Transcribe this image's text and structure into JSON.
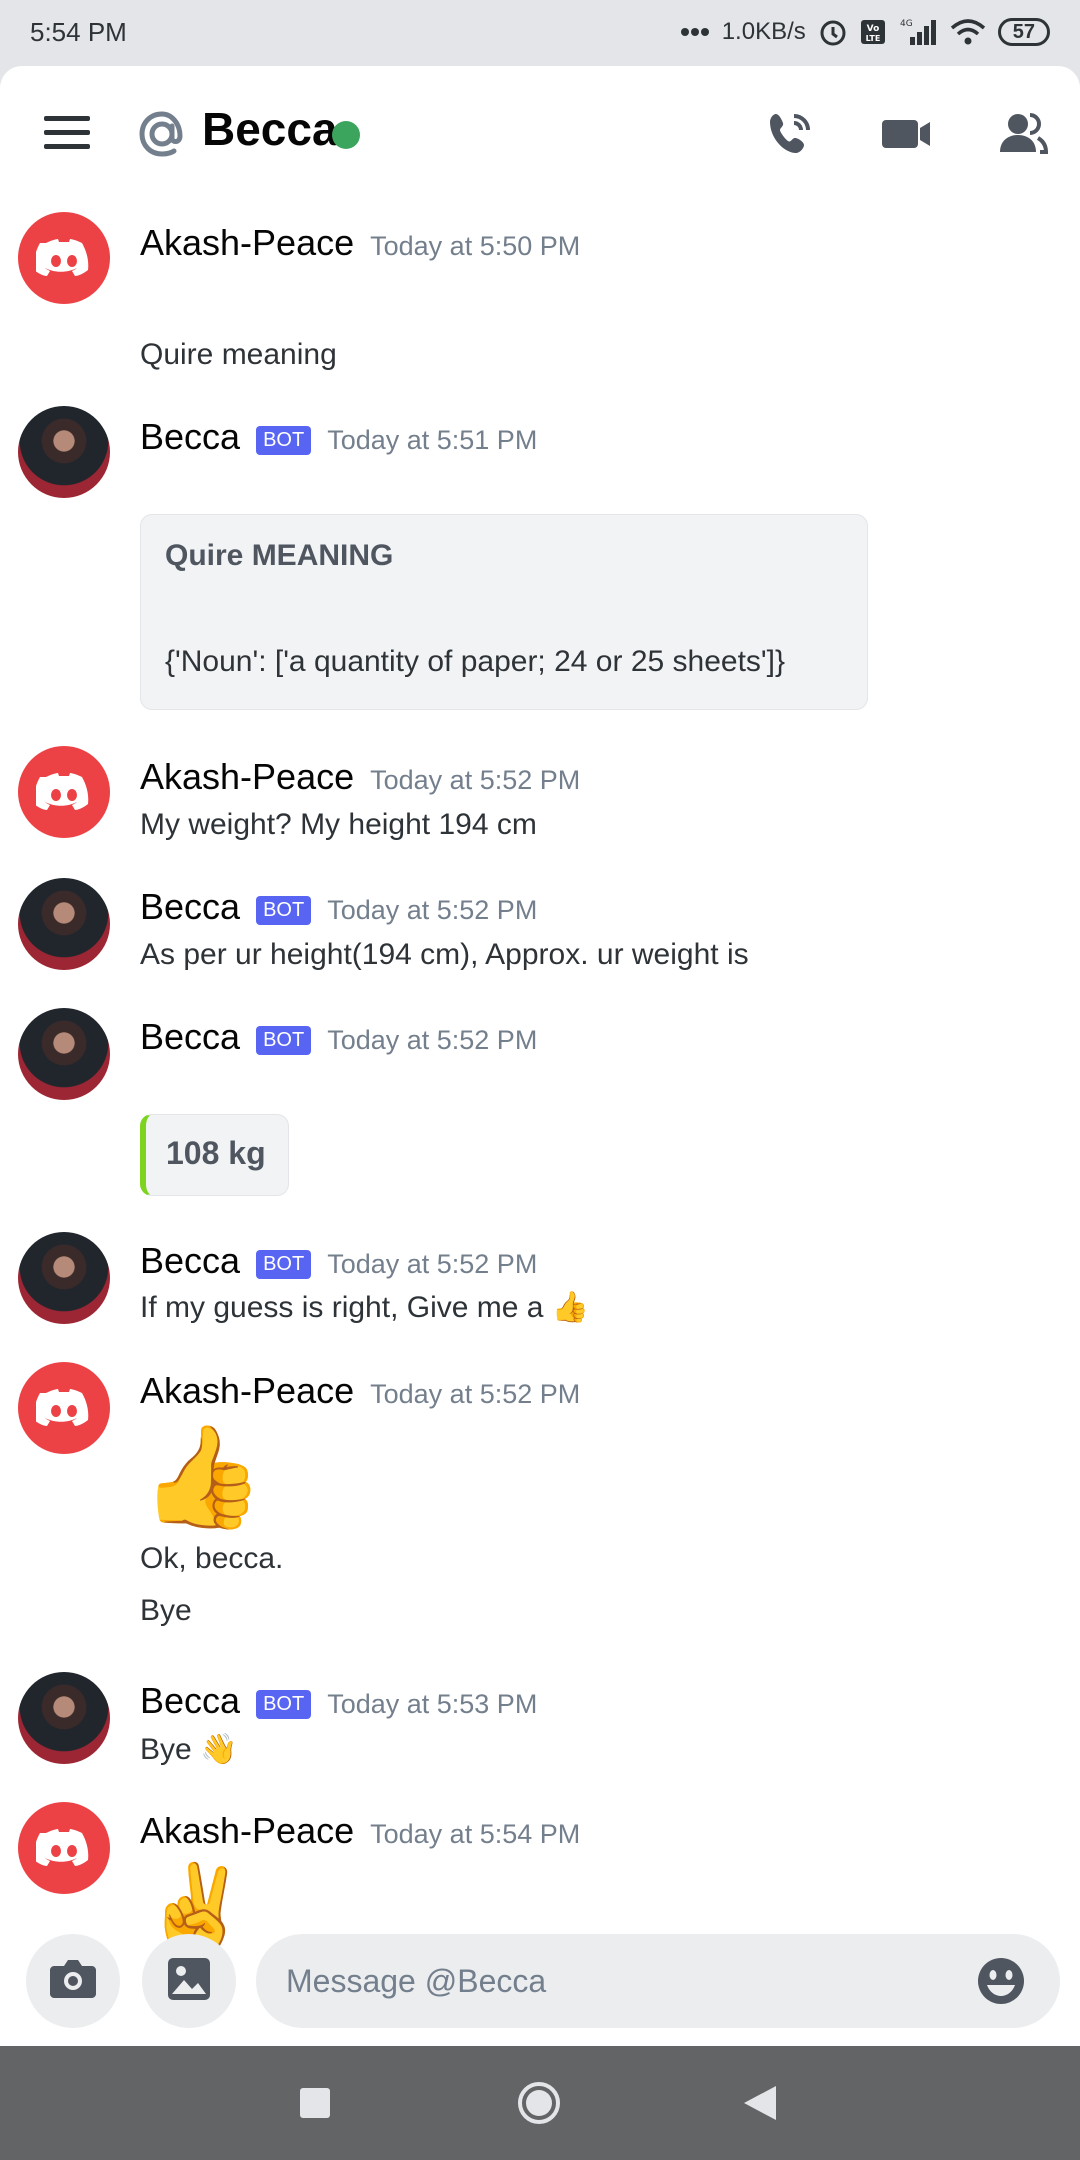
{
  "status": {
    "time": "5:54 PM",
    "network_speed": "1.0KB/s",
    "volte": "Vo LTE",
    "signal_label": "4G",
    "battery": "57",
    "icons": [
      "more-dots-icon",
      "alarm-icon",
      "volte-icon",
      "signal-icon",
      "wifi-icon",
      "battery-icon"
    ]
  },
  "header": {
    "title": "Becca",
    "status_color": "#3ba55d",
    "icons": [
      "menu-icon",
      "at-icon",
      "phone-call-icon",
      "video-camera-icon",
      "members-icon"
    ]
  },
  "colors": {
    "accent": "#5865f2",
    "discord_red": "#ed4245",
    "embed_bar": "#7ed321"
  },
  "messages": [
    {
      "author": "Akash-Peace",
      "avatar": "discord-avatar",
      "timestamp": "Today at 5:50 PM",
      "text": "Quire meaning"
    },
    {
      "author": "Becca",
      "avatar": "becca-avatar",
      "bot": "BOT",
      "timestamp": "Today at 5:51 PM",
      "embed": {
        "title": "Quire  MEANING",
        "body": "{'Noun': ['a quantity of paper; 24 or 25 sheets']}"
      }
    },
    {
      "author": "Akash-Peace",
      "avatar": "discord-avatar",
      "timestamp": "Today at 5:52 PM",
      "text": "My weight? My height 194 cm"
    },
    {
      "author": "Becca",
      "avatar": "becca-avatar",
      "bot": "BOT",
      "timestamp": "Today at 5:52 PM",
      "text": "As per ur height(194 cm), Approx. ur weight is"
    },
    {
      "author": "Becca",
      "avatar": "becca-avatar",
      "bot": "BOT",
      "timestamp": "Today at 5:52 PM",
      "embed": {
        "title": "108 kg"
      }
    },
    {
      "author": "Becca",
      "avatar": "becca-avatar",
      "bot": "BOT",
      "timestamp": "Today at 5:52 PM",
      "text": "If my guess is right, Give me a",
      "emoji": "👍"
    },
    {
      "author": "Akash-Peace",
      "avatar": "discord-avatar",
      "timestamp": "Today at 5:52 PM",
      "big_emoji": "👍",
      "lines": [
        "Ok, becca.",
        "Bye"
      ]
    },
    {
      "author": "Becca",
      "avatar": "becca-avatar",
      "bot": "BOT",
      "timestamp": "Today at 5:53 PM",
      "text": "Bye",
      "emoji": "👋"
    },
    {
      "author": "Akash-Peace",
      "avatar": "discord-avatar",
      "timestamp": "Today at 5:54 PM",
      "big_emoji": "✌️"
    }
  ],
  "composer": {
    "placeholder": "Message @Becca",
    "icons": [
      "camera-icon",
      "image-icon",
      "emoji-icon"
    ]
  },
  "nav": {
    "icons": [
      "recent-apps-icon",
      "home-icon",
      "back-icon"
    ]
  }
}
